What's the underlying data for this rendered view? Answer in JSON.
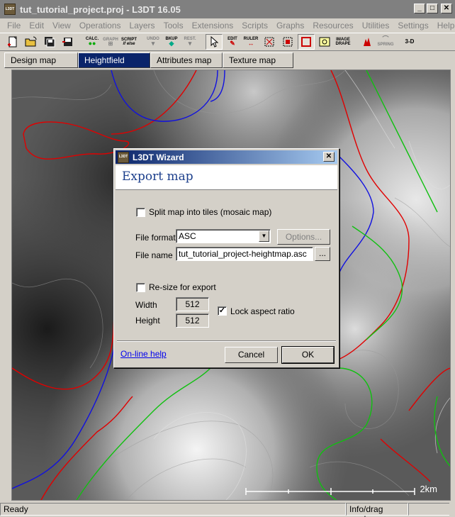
{
  "window": {
    "title": "tut_tutorial_project.proj - L3DT 16.05",
    "icon_text": "L3DT",
    "buttons": [
      "_",
      "□",
      "✕"
    ]
  },
  "menu": [
    "File",
    "Edit",
    "View",
    "Operations",
    "Layers",
    "Tools",
    "Extensions",
    "Scripts",
    "Graphs",
    "Resources",
    "Utilities",
    "Settings",
    "Help"
  ],
  "toolbar": {
    "calc": "CALC.",
    "graph": "GRAPH",
    "script": "SCRIPT",
    "script_sub": "if else",
    "undo": "UNDO",
    "bkup": "BKUP",
    "rest": "REST.",
    "edit": "EDIT",
    "ruler": "RULER",
    "image": "IMAGE",
    "drape": "DRAPE",
    "spring": "SPRING",
    "three_d": "3-D"
  },
  "tabs": [
    {
      "label": "Design map",
      "active": false
    },
    {
      "label": "Heightfield",
      "active": true
    },
    {
      "label": "Attributes map",
      "active": false
    },
    {
      "label": "Texture map",
      "active": false
    }
  ],
  "map": {
    "scale_label": "2km"
  },
  "dialog": {
    "title": "L3DT Wizard",
    "heading": "Export map",
    "split_tiles_label": "Split map into tiles (mosaic map)",
    "split_tiles_checked": false,
    "file_format_label": "File format",
    "file_format_value": "ASC",
    "options_button": "Options...",
    "file_name_label": "File name",
    "file_name_value": "tut_tutorial_project-heightmap.asc",
    "browse_button": "...",
    "resize_label": "Re-size for export",
    "resize_checked": false,
    "width_label": "Width",
    "width_value": "512",
    "height_label": "Height",
    "height_value": "512",
    "lock_aspect_label": "Lock aspect ratio",
    "lock_aspect_checked": true,
    "help_link": "On-line help",
    "cancel_button": "Cancel",
    "ok_button": "OK"
  },
  "status": {
    "left": "Ready",
    "mode": "Info/drag mode"
  },
  "colors": {
    "titlebar_inactive": "#808080",
    "dialog_titlebar": "#0a246a",
    "active_tab": "#0a246a",
    "contour_red": "#e00000",
    "contour_blue": "#1010e0",
    "contour_green": "#10c010"
  }
}
